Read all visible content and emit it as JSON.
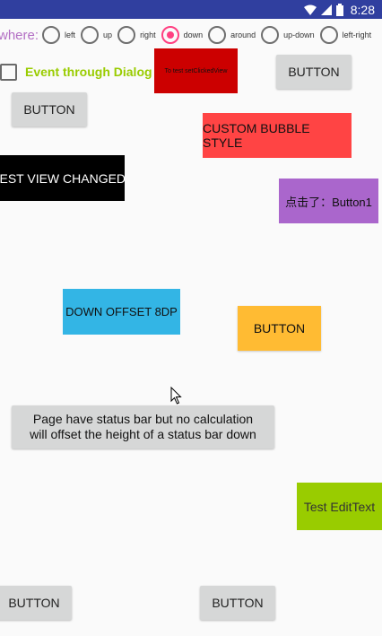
{
  "status_bar": {
    "time": "8:28",
    "icons": [
      "wifi-icon",
      "signal-icon",
      "battery-icon"
    ]
  },
  "where_row": {
    "label": "where:",
    "options": [
      {
        "label": "left",
        "checked": false
      },
      {
        "label": "up",
        "checked": false
      },
      {
        "label": "right",
        "checked": false
      },
      {
        "label": "down",
        "checked": true
      },
      {
        "label": "around",
        "checked": false
      },
      {
        "label": "up-down",
        "checked": false
      },
      {
        "label": "left-right",
        "checked": false
      }
    ]
  },
  "checkbox": {
    "label": "Event through Dialog",
    "checked": false
  },
  "views": {
    "red_box_text": "To test setClickedView",
    "top_right_button": "BUTTON",
    "left_button": "BUTTON",
    "bubble_text": "CUSTOM BUBBLE STYLE",
    "black_box_text": "TEST VIEW CHANGED",
    "purple_box_text": "点击了：Button1",
    "blue_box_text": "DOWN OFFSET 8DP",
    "yellow_button": "BUTTON",
    "status_button_line1": "Page have status bar but no calculation",
    "status_button_line2": "will offset the height of a status bar down",
    "edit_text": "Test EditText",
    "bottom_left_button": "BUTTON",
    "bottom_center_button": "BUTTON"
  },
  "colors": {
    "status_bar": "#303f9f",
    "accent": "#ff4081",
    "where_label": "#b36fc4",
    "checkbox_label": "#99cc00",
    "red_box": "#cc0000",
    "bubble": "#ff4444",
    "purple": "#aa66cc",
    "blue": "#33b5e5",
    "yellow": "#ffbb33",
    "green": "#99cc00"
  }
}
